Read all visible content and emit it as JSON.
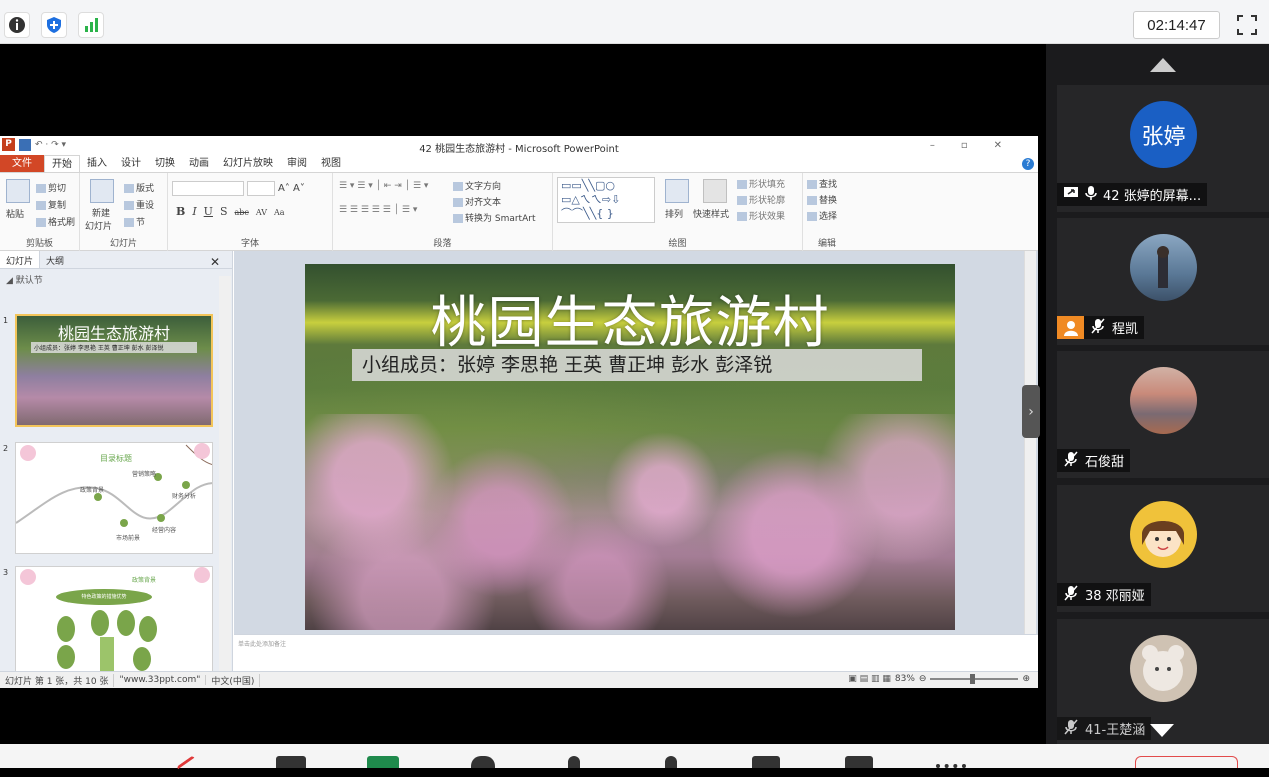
{
  "topbar": {
    "timer": "02:14:47",
    "icons": [
      "info-icon",
      "shield-icon",
      "signal-icon"
    ]
  },
  "ppt": {
    "window_title": "42  桃园生态旅游村 - Microsoft PowerPoint",
    "tabs": [
      "文件",
      "开始",
      "插入",
      "设计",
      "切换",
      "动画",
      "幻灯片放映",
      "审阅",
      "视图"
    ],
    "active_tab": "开始",
    "ribbon": {
      "clipboard": {
        "paste": "粘贴",
        "cut": "剪切",
        "copy": "复制",
        "format_painter": "格式刷",
        "label": "剪贴板"
      },
      "slides": {
        "new_slide": "新建",
        "new_slide2": "幻灯片",
        "layout": "版式",
        "reset": "重设",
        "section": "节",
        "label": "幻灯片"
      },
      "font": {
        "label": "字体",
        "bold": "B",
        "italic": "I",
        "underline": "U",
        "shadow": "S",
        "strike": "abc",
        "spacing": "AV",
        "case": "Aa"
      },
      "paragraph": {
        "label": "段落",
        "text_direction": "文字方向",
        "align_text": "对齐文本",
        "smartart": "转换为 SmartArt"
      },
      "drawing": {
        "label": "绘图",
        "arrange": "排列",
        "quick_styles": "快速样式",
        "shape_fill": "形状填充",
        "shape_outline": "形状轮廓",
        "shape_effects": "形状效果"
      },
      "editing": {
        "label": "编辑",
        "find": "查找",
        "replace": "替换",
        "select": "选择"
      }
    },
    "left_pane": {
      "tabs": [
        "幻灯片",
        "大纲"
      ],
      "section": "默认节",
      "thumbs": [
        {
          "num": "1",
          "title": "桃园生态旅游村",
          "subtitle": "小组成员：张婷 李思艳 王英 曹正坤 彭水 彭泽锐"
        },
        {
          "num": "2",
          "title": "目录标题",
          "items": [
            "政策背景",
            "营销策略",
            "财务分析",
            "市场前景",
            "经营内容"
          ]
        },
        {
          "num": "3",
          "title": "政策背景",
          "banner": "特色政策的措施优势"
        }
      ]
    },
    "slide": {
      "title": "桃园生态旅游村",
      "members": "小组成员：张婷  李思艳   王英   曹正坤  彭水   彭泽锐"
    },
    "notes_placeholder": "单击此处添加备注",
    "status": {
      "slide_info": "幻灯片 第 1 张，共 10 张",
      "theme": "\"www.33ppt.com\"",
      "language": "中文(中国)",
      "zoom": "83%"
    }
  },
  "participants": [
    {
      "name": "42  张婷的屏幕...",
      "avatar_text": "张婷",
      "avatar_color": "#1a5fc4",
      "state": "sharing"
    },
    {
      "name": "程凯",
      "avatar_text": "",
      "avatar_color": "#7a93ad",
      "state": "muted"
    },
    {
      "name": "石俊甜",
      "avatar_text": "",
      "avatar_color": "#c98a7a",
      "state": "muted"
    },
    {
      "name": "38  邓丽娅",
      "avatar_text": "",
      "avatar_color": "#f0c23a",
      "state": "muted"
    },
    {
      "name": "41-王楚涵",
      "avatar_text": "",
      "avatar_color": "#d9cfc4",
      "state": "muted"
    }
  ]
}
